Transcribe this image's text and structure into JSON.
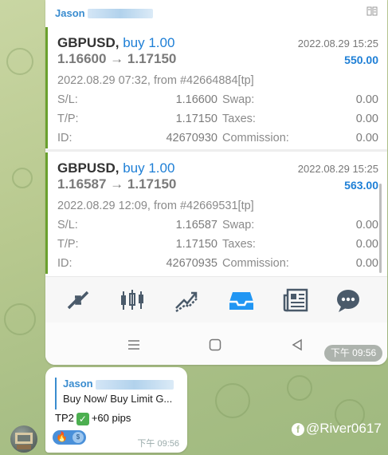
{
  "sender": {
    "name": "Jason"
  },
  "trades": [
    {
      "symbol": "GBPUSD,",
      "side": "buy 1.00",
      "close_time": "2022.08.29 15:25",
      "prices": "1.16600 → 1.17150",
      "profit": "550.00",
      "opened": "2022.08.29 07:32, from #42664884[tp]",
      "sl_label": "S/L:",
      "sl": "1.16600",
      "swap_label": "Swap:",
      "swap": "0.00",
      "tp_label": "T/P:",
      "tp": "1.17150",
      "taxes_label": "Taxes:",
      "taxes": "0.00",
      "id_label": "ID:",
      "id": "42670930",
      "commission_label": "Commission:",
      "commission": "0.00"
    },
    {
      "symbol": "GBPUSD,",
      "side": "buy 1.00",
      "close_time": "2022.08.29 15:25",
      "prices": "1.16587 → 1.17150",
      "profit": "563.00",
      "opened": "2022.08.29 12:09, from #42669531[tp]",
      "sl_label": "S/L:",
      "sl": "1.16587",
      "swap_label": "Swap:",
      "swap": "0.00",
      "tp_label": "T/P:",
      "tp": "1.17150",
      "taxes_label": "Taxes:",
      "taxes": "0.00",
      "id_label": "ID:",
      "id": "42670935",
      "commission_label": "Commission:",
      "commission": "0.00"
    }
  ],
  "tabs": [
    "quotes-icon",
    "chart-icon",
    "trade-icon",
    "history-icon",
    "news-icon",
    "chat-icon"
  ],
  "active_tab": "history-icon",
  "colors": {
    "accent": "#1e7fd6",
    "active_tab": "#2196f3",
    "card_border": "#6aa02d"
  },
  "message1": {
    "time": "下午 09:56"
  },
  "message2": {
    "reply_name": "Jason",
    "reply_text": "Buy Now/ Buy Limit G...",
    "text_before": "TP2",
    "text_after": "+60 pips",
    "reaction_emoji": "🔥",
    "time": "下午 09:56"
  },
  "watermark": "@River0617"
}
